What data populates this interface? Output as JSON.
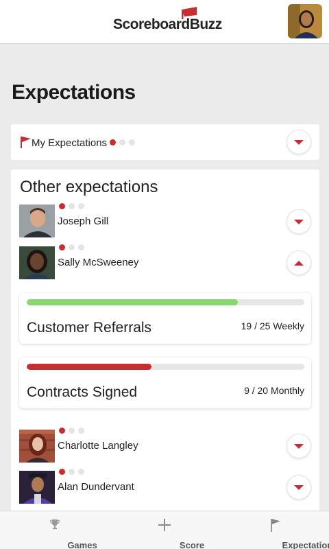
{
  "header": {
    "logo_text": "ScoreboardBuzz",
    "brand_color": "#c62f2f",
    "avatar_icon": "user-avatar-icon"
  },
  "page": {
    "title": "Expectations"
  },
  "my_expectations": {
    "label": "My Expectations",
    "icon": "flag-icon",
    "status_dots": [
      true,
      false,
      false
    ],
    "expanded": false
  },
  "other_expectations": {
    "title": "Other expectations",
    "people": [
      {
        "name": "Joseph Gill",
        "status_dots": [
          true,
          false,
          false
        ],
        "expanded": false
      },
      {
        "name": "Sally McSweeney",
        "status_dots": [
          true,
          false,
          false
        ],
        "expanded": true,
        "metrics": [
          {
            "name": "Customer Referrals",
            "value": "19 / 25 Weekly",
            "progress": 0.76,
            "color": "#88d770"
          },
          {
            "name": "Contracts Signed",
            "value": "9 / 20 Monthly",
            "progress": 0.45,
            "color": "#c62f2f"
          }
        ]
      },
      {
        "name": "Charlotte Langley",
        "status_dots": [
          true,
          false,
          false
        ],
        "expanded": false
      },
      {
        "name": "Alan Dundervant",
        "status_dots": [
          true,
          false,
          false
        ],
        "expanded": false
      }
    ]
  },
  "bottom_nav": {
    "items": [
      {
        "label": "Games",
        "icon": "trophy-icon"
      },
      {
        "label": "Score",
        "icon": "plus-icon"
      },
      {
        "label": "Expectations",
        "icon": "flag-icon"
      }
    ]
  }
}
